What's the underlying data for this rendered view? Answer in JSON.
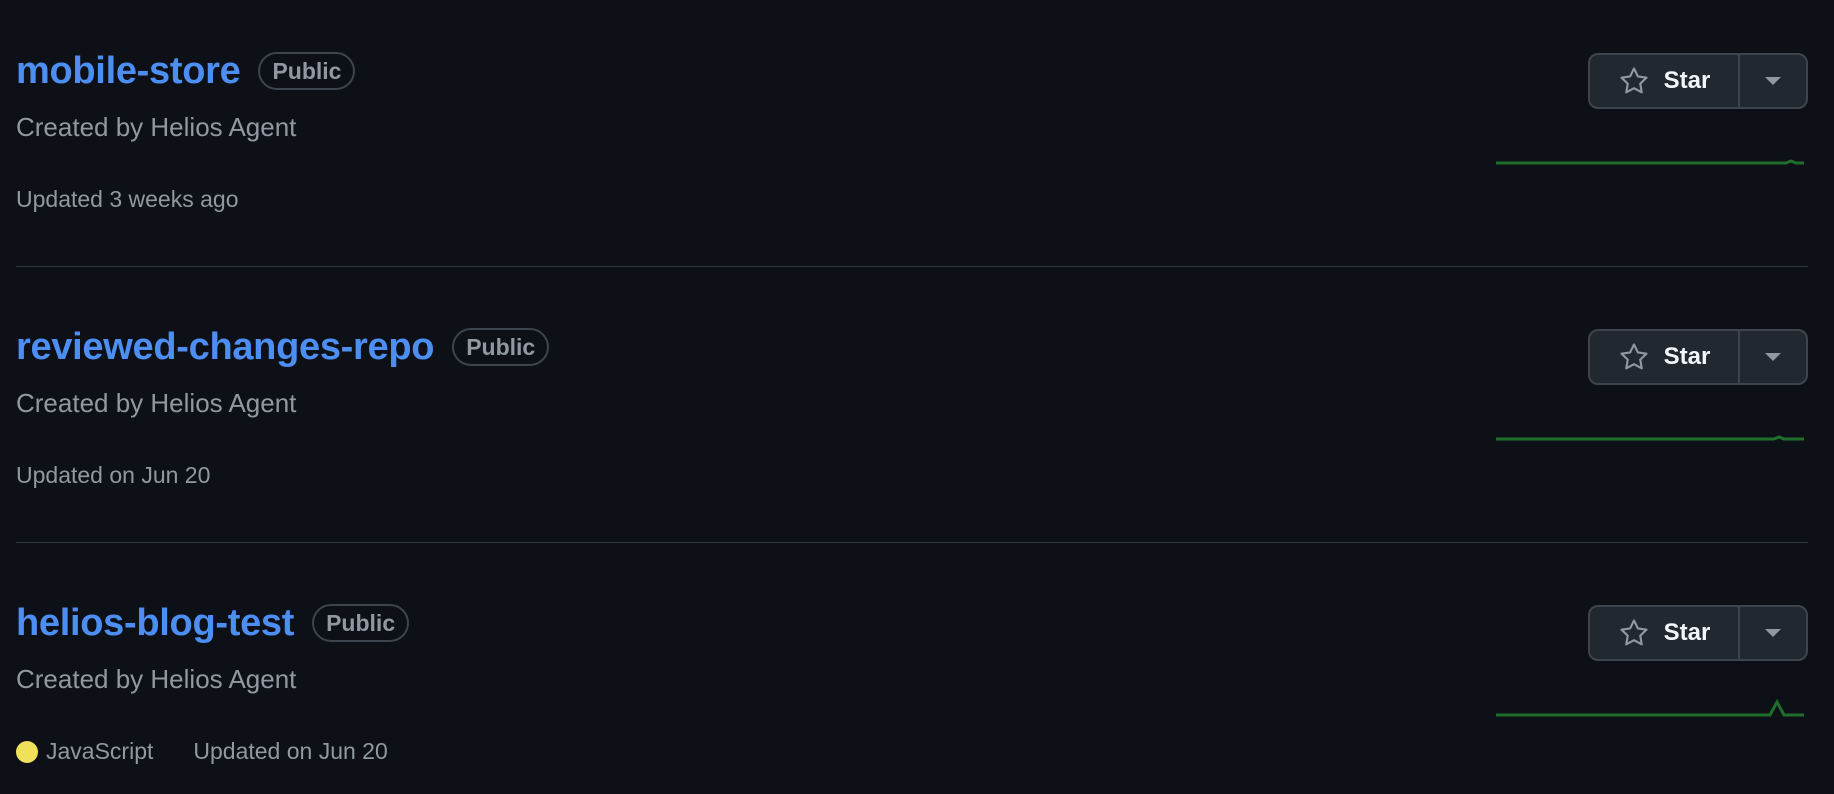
{
  "repos": [
    {
      "name": "mobile-store",
      "visibility": "Public",
      "description": "Created by Helios Agent",
      "language": "",
      "updated": "Updated 3 weeks ago",
      "star_label": "Star"
    },
    {
      "name": "reviewed-changes-repo",
      "visibility": "Public",
      "description": "Created by Helios Agent",
      "language": "",
      "updated": "Updated on Jun 20",
      "star_label": "Star"
    },
    {
      "name": "helios-blog-test",
      "visibility": "Public",
      "description": "Created by Helios Agent",
      "language": "JavaScript",
      "language_color": "#f1e05a",
      "updated": "Updated on Jun 20",
      "star_label": "Star"
    }
  ],
  "icons": {
    "star": "star-icon",
    "dropdown": "triangle-down-icon"
  },
  "colors": {
    "background": "#0d1117",
    "link": "#4d8ef2",
    "muted": "#9198a1",
    "spark": "#1f6f2b"
  }
}
